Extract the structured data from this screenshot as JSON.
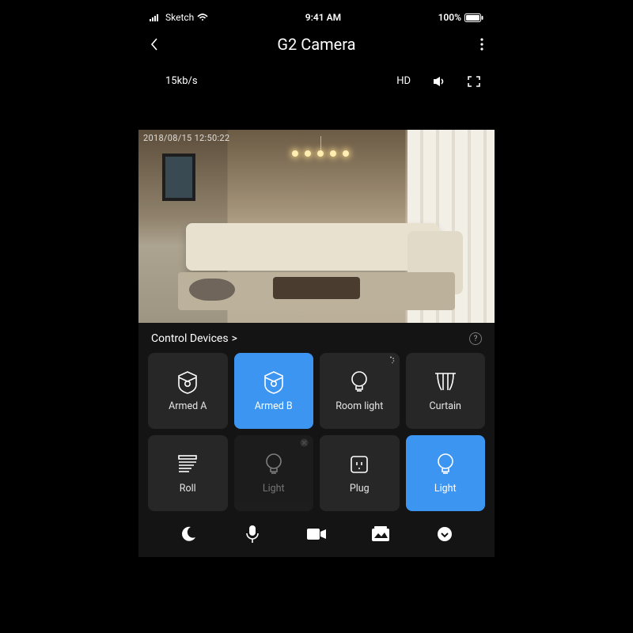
{
  "status": {
    "carrier": "Sketch",
    "time": "9:41 AM",
    "battery": "100%"
  },
  "nav": {
    "title": "G2 Camera"
  },
  "stream": {
    "bitrate": "15kb/s",
    "quality": "HD"
  },
  "video": {
    "timestamp": "2018/08/15 12:50:22"
  },
  "panel": {
    "header": "Control Devices",
    "chevron": ">",
    "help": "?"
  },
  "tiles": [
    {
      "label": "Armed A",
      "icon": "shield-icon",
      "active": false
    },
    {
      "label": "Armed B",
      "icon": "shield-icon",
      "active": true
    },
    {
      "label": "Room light",
      "icon": "bulb-icon",
      "active": false,
      "corner": "loading"
    },
    {
      "label": "Curtain",
      "icon": "curtain-icon",
      "active": false
    },
    {
      "label": "Roll",
      "icon": "roll-icon",
      "active": false
    },
    {
      "label": "Light",
      "icon": "bulb-icon",
      "active": false,
      "dim": true,
      "corner": "disabled"
    },
    {
      "label": "Plug",
      "icon": "plug-icon",
      "active": false
    },
    {
      "label": "Light",
      "icon": "bulb-icon",
      "active": true
    }
  ],
  "bottom": [
    "moon-icon",
    "mic-icon",
    "record-icon",
    "gallery-icon",
    "circle-down-icon"
  ]
}
